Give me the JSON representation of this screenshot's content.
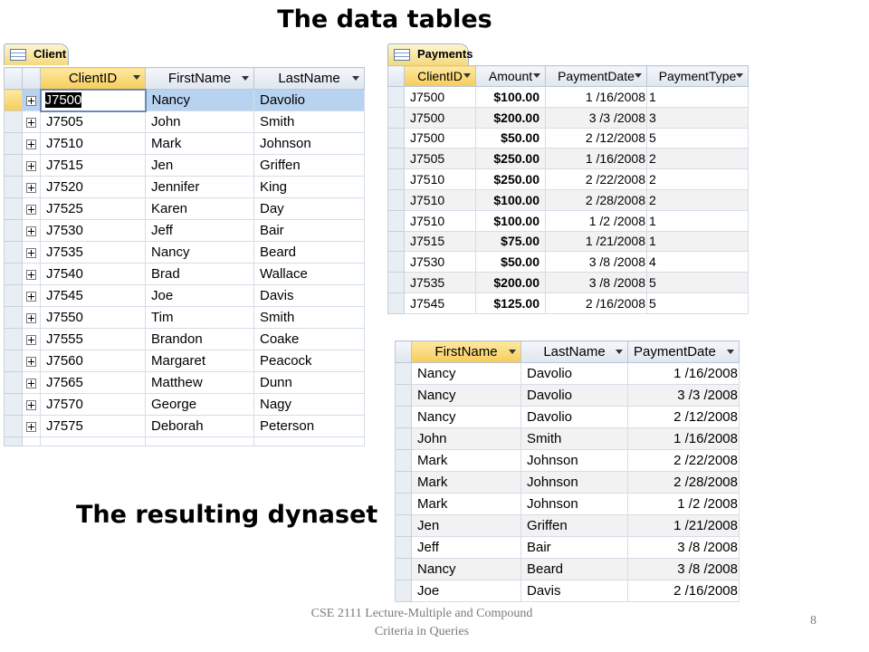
{
  "titles": {
    "main": "The data tables",
    "dynaset": "The resulting dynaset"
  },
  "footer": {
    "line1": "CSE 2111 Lecture-Multiple and Compound",
    "line2": "Criteria in Queries",
    "page": "8"
  },
  "client": {
    "tab_label": "Client",
    "headers": [
      "ClientID",
      "FirstName",
      "LastName"
    ],
    "rows": [
      [
        "J7500",
        "Nancy",
        "Davolio"
      ],
      [
        "J7505",
        "John",
        "Smith"
      ],
      [
        "J7510",
        "Mark",
        "Johnson"
      ],
      [
        "J7515",
        "Jen",
        "Griffen"
      ],
      [
        "J7520",
        "Jennifer",
        "King"
      ],
      [
        "J7525",
        "Karen",
        "Day"
      ],
      [
        "J7530",
        "Jeff",
        "Bair"
      ],
      [
        "J7535",
        "Nancy",
        "Beard"
      ],
      [
        "J7540",
        "Brad",
        "Wallace"
      ],
      [
        "J7545",
        "Joe",
        "Davis"
      ],
      [
        "J7550",
        "Tim",
        "Smith"
      ],
      [
        "J7555",
        "Brandon",
        "Coake"
      ],
      [
        "J7560",
        "Margaret",
        "Peacock"
      ],
      [
        "J7565",
        "Matthew",
        "Dunn"
      ],
      [
        "J7570",
        "George",
        "Nagy"
      ],
      [
        "J7575",
        "Deborah",
        "Peterson"
      ]
    ]
  },
  "payments": {
    "tab_label": "Payments",
    "headers": [
      "ClientID",
      "Amount",
      "PaymentDate",
      "PaymentType"
    ],
    "rows": [
      [
        "J7500",
        "$100.00",
        "1 /16/2008",
        "1"
      ],
      [
        "J7500",
        "$200.00",
        "3 /3 /2008",
        "3"
      ],
      [
        "J7500",
        "$50.00",
        "2 /12/2008",
        "5"
      ],
      [
        "J7505",
        "$250.00",
        "1 /16/2008",
        "2"
      ],
      [
        "J7510",
        "$250.00",
        "2 /22/2008",
        "2"
      ],
      [
        "J7510",
        "$100.00",
        "2 /28/2008",
        "2"
      ],
      [
        "J7510",
        "$100.00",
        "1 /2 /2008",
        "1"
      ],
      [
        "J7515",
        "$75.00",
        "1 /21/2008",
        "1"
      ],
      [
        "J7530",
        "$50.00",
        "3 /8 /2008",
        "4"
      ],
      [
        "J7535",
        "$200.00",
        "3 /8 /2008",
        "5"
      ],
      [
        "J7545",
        "$125.00",
        "2 /16/2008",
        "5"
      ]
    ]
  },
  "dynaset": {
    "headers": [
      "FirstName",
      "LastName",
      "PaymentDate"
    ],
    "rows": [
      [
        "Nancy",
        "Davolio",
        "1 /16/2008"
      ],
      [
        "Nancy",
        "Davolio",
        "3 /3 /2008"
      ],
      [
        "Nancy",
        "Davolio",
        "2 /12/2008"
      ],
      [
        "John",
        "Smith",
        "1 /16/2008"
      ],
      [
        "Mark",
        "Johnson",
        "2 /22/2008"
      ],
      [
        "Mark",
        "Johnson",
        "2 /28/2008"
      ],
      [
        "Mark",
        "Johnson",
        "1 /2 /2008"
      ],
      [
        "Jen",
        "Griffen",
        "1 /21/2008"
      ],
      [
        "Jeff",
        "Bair",
        "3 /8 /2008"
      ],
      [
        "Nancy",
        "Beard",
        "3 /8 /2008"
      ],
      [
        "Joe",
        "Davis",
        "2 /16/2008"
      ]
    ]
  }
}
